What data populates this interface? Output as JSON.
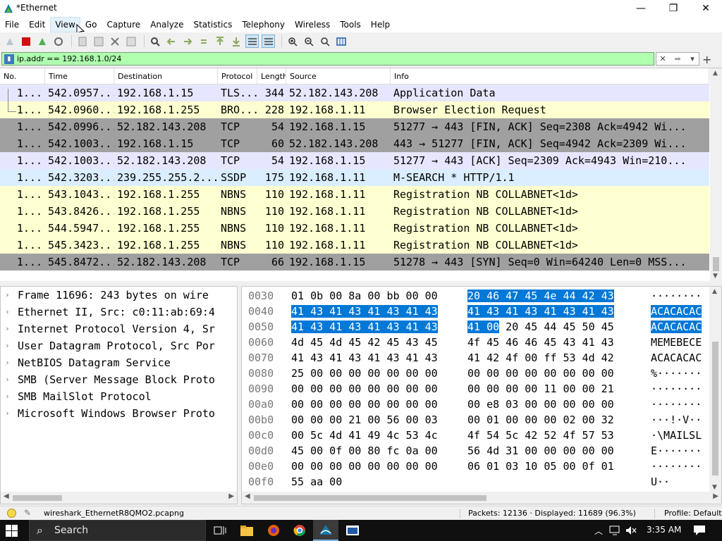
{
  "window": {
    "title": "*Ethernet",
    "minimize": "—",
    "maximize": "❐",
    "close": "✕"
  },
  "menu": [
    "File",
    "Edit",
    "View",
    "Go",
    "Capture",
    "Analyze",
    "Statistics",
    "Telephony",
    "Wireless",
    "Tools",
    "Help"
  ],
  "filter": {
    "value": "ip.addr == 192.168.1.0/24",
    "clear_icon": "✕",
    "apply_icon": "➡",
    "dropdown_icon": "▾",
    "add_icon": "+"
  },
  "packet_list": {
    "columns": [
      "No.",
      "Time",
      "Destination",
      "Protocol",
      "Length",
      "Source",
      "Info"
    ],
    "rows": [
      {
        "no": "1...",
        "time": "542.0957...",
        "dst": "192.168.1.15",
        "proto": "TLS...",
        "len": "344",
        "src": "52.182.143.208",
        "info": "Application Data",
        "bg": "#e7e6ff"
      },
      {
        "no": "1...",
        "time": "542.0960...",
        "dst": "192.168.1.255",
        "proto": "BRO...",
        "len": "228",
        "src": "192.168.1.11",
        "info": "Browser Election Request",
        "bg": "#feffd0"
      },
      {
        "no": "1...",
        "time": "542.0996...",
        "dst": "52.182.143.208",
        "proto": "TCP",
        "len": "54",
        "src": "192.168.1.15",
        "info": "51277 → 443 [FIN, ACK] Seq=2308 Ack=4942 Wi...",
        "bg": "#a0a0a0"
      },
      {
        "no": "1...",
        "time": "542.1003...",
        "dst": "192.168.1.15",
        "proto": "TCP",
        "len": "60",
        "src": "52.182.143.208",
        "info": "443 → 51277 [FIN, ACK] Seq=4942 Ack=2309 Wi...",
        "bg": "#a0a0a0"
      },
      {
        "no": "1...",
        "time": "542.1003...",
        "dst": "52.182.143.208",
        "proto": "TCP",
        "len": "54",
        "src": "192.168.1.15",
        "info": "51277 → 443 [ACK] Seq=2309 Ack=4943 Win=210...",
        "bg": "#e7e6ff"
      },
      {
        "no": "1...",
        "time": "542.3203...",
        "dst": "239.255.255.2...",
        "proto": "SSDP",
        "len": "175",
        "src": "192.168.1.11",
        "info": "M-SEARCH * HTTP/1.1",
        "bg": "#daeeff"
      },
      {
        "no": "1...",
        "time": "543.1043...",
        "dst": "192.168.1.255",
        "proto": "NBNS",
        "len": "110",
        "src": "192.168.1.11",
        "info": "Registration NB COLLABNET<1d>",
        "bg": "#feffd0"
      },
      {
        "no": "1...",
        "time": "543.8426...",
        "dst": "192.168.1.255",
        "proto": "NBNS",
        "len": "110",
        "src": "192.168.1.11",
        "info": "Registration NB COLLABNET<1d>",
        "bg": "#feffd0"
      },
      {
        "no": "1...",
        "time": "544.5947...",
        "dst": "192.168.1.255",
        "proto": "NBNS",
        "len": "110",
        "src": "192.168.1.11",
        "info": "Registration NB COLLABNET<1d>",
        "bg": "#feffd0"
      },
      {
        "no": "1...",
        "time": "545.3423...",
        "dst": "192.168.1.255",
        "proto": "NBNS",
        "len": "110",
        "src": "192.168.1.11",
        "info": "Registration NB COLLABNET<1d>",
        "bg": "#feffd0"
      },
      {
        "no": "1...",
        "time": "545.8472...",
        "dst": "52.182.143.208",
        "proto": "TCP",
        "len": "66",
        "src": "192.168.1.15",
        "info": "51278 → 443 [SYN] Seq=0 Win=64240 Len=0 MSS...",
        "bg": "#a0a0a0"
      }
    ]
  },
  "details": {
    "items": [
      "Frame 11696: 243 bytes on wire",
      "Ethernet II, Src: c0:11:ab:69:4",
      "Internet Protocol Version 4, Sr",
      "User Datagram Protocol, Src Por",
      "NetBIOS Datagram Service",
      "SMB (Server Message Block Proto",
      "SMB MailSlot Protocol",
      "Microsoft Windows Browser Proto"
    ]
  },
  "bytes": {
    "rows": [
      {
        "offset": "0030",
        "hex1": "01 0b 00 8a 00 bb 00 00",
        "hex2": "20 46 47 45 4e 44 42 43",
        "ascii": "········",
        "hl": "hex2"
      },
      {
        "offset": "0040",
        "hex1": "41 43 41 43 41 43 41 43",
        "hex2": "41 43 41 43 41 43 41 43",
        "ascii": "ACACACAC",
        "hl": "all"
      },
      {
        "offset": "0050",
        "hex1": "41 43 41 43 41 43 41 43",
        "hex2": "41 00",
        "hex2b": " 20 45 44 45 50 45",
        "ascii": "ACACACAC",
        "hl": "partial"
      },
      {
        "offset": "0060",
        "hex1": "4d 45 4d 45 42 45 43 45",
        "hex2": "4f 45 46 46 45 43 41 43",
        "ascii": "MEMEBECE",
        "hl": "none"
      },
      {
        "offset": "0070",
        "hex1": "41 43 41 43 41 43 41 43",
        "hex2": "41 42 4f 00 ff 53 4d 42",
        "ascii": "ACACACAC",
        "hl": "none"
      },
      {
        "offset": "0080",
        "hex1": "25 00 00 00 00 00 00 00",
        "hex2": "00 00 00 00 00 00 00 00",
        "ascii": "%·······",
        "hl": "none"
      },
      {
        "offset": "0090",
        "hex1": "00 00 00 00 00 00 00 00",
        "hex2": "00 00 00 00 11 00 00 21",
        "ascii": "········",
        "hl": "none"
      },
      {
        "offset": "00a0",
        "hex1": "00 00 00 00 00 00 00 00",
        "hex2": "00 e8 03 00 00 00 00 00",
        "ascii": "········",
        "hl": "none"
      },
      {
        "offset": "00b0",
        "hex1": "00 00 00 21 00 56 00 03",
        "hex2": "00 01 00 00 00 02 00 32",
        "ascii": "···!·V··",
        "hl": "none"
      },
      {
        "offset": "00c0",
        "hex1": "00 5c 4d 41 49 4c 53 4c",
        "hex2": "4f 54 5c 42 52 4f 57 53",
        "ascii": "·\\MAILSL",
        "hl": "none"
      },
      {
        "offset": "00d0",
        "hex1": "45 00 0f 00 80 fc 0a 00",
        "hex2": "56 4d 31 00 00 00 00 00",
        "ascii": "E·······",
        "hl": "none"
      },
      {
        "offset": "00e0",
        "hex1": "00 00 00 00 00 00 00 00",
        "hex2": "06 01 03 10 05 00 0f 01",
        "ascii": "········",
        "hl": "none"
      },
      {
        "offset": "00f0",
        "hex1": "55 aa 00",
        "hex2": "",
        "ascii": "U··",
        "hl": "none"
      }
    ]
  },
  "status": {
    "file": "wireshark_EthernetR8QMO2.pcapng",
    "packets": "Packets: 12136 · Displayed: 11689 (96.3%)",
    "profile": "Profile: Default"
  },
  "taskbar": {
    "search_label": "Search",
    "time": "3:35 AM"
  },
  "colors": {
    "filter_valid": "#afffaf",
    "selection": "#0078d7"
  }
}
